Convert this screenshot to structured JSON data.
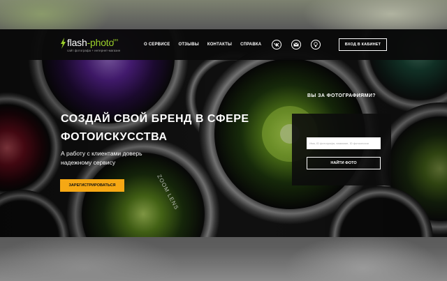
{
  "header": {
    "logo": {
      "title_part1": "flash",
      "title_part2": "-photo",
      "suffix": "pro",
      "tagline": "сайт фотографа + интернет-магазин"
    },
    "nav": [
      {
        "label": "О СЕРВИСЕ"
      },
      {
        "label": "ОТЗЫВЫ"
      },
      {
        "label": "КОНТАКТЫ"
      },
      {
        "label": "СПРАВКА"
      }
    ],
    "social_icons": [
      "vk-icon",
      "mail-icon",
      "lightbulb-icon"
    ],
    "login_label": "ВХОД В КАБИНЕТ"
  },
  "hero": {
    "headline_line1": "СОЗДАЙ СВОЙ БРЕНД В СФЕРЕ",
    "headline_line2": "ФОТОИСКУССТВА",
    "sub_line1": "А работу с клиентами доверь",
    "sub_line2": "надежному сервису",
    "register_label": "ЗАРЕГИСТРИРОВАТЬСЯ",
    "lens_text": "ZOOM LENS"
  },
  "search": {
    "title": "ВЫ ЗА ФОТОГРАФИЯМИ?",
    "placeholder": "Имя, ID фотографа, название, ID фотосессии",
    "button_label": "НАЙТИ ФОТО"
  },
  "colors": {
    "accent_green": "#9bd02a",
    "cta_orange": "#f6a814",
    "header_bg": "#0a0a0a"
  }
}
